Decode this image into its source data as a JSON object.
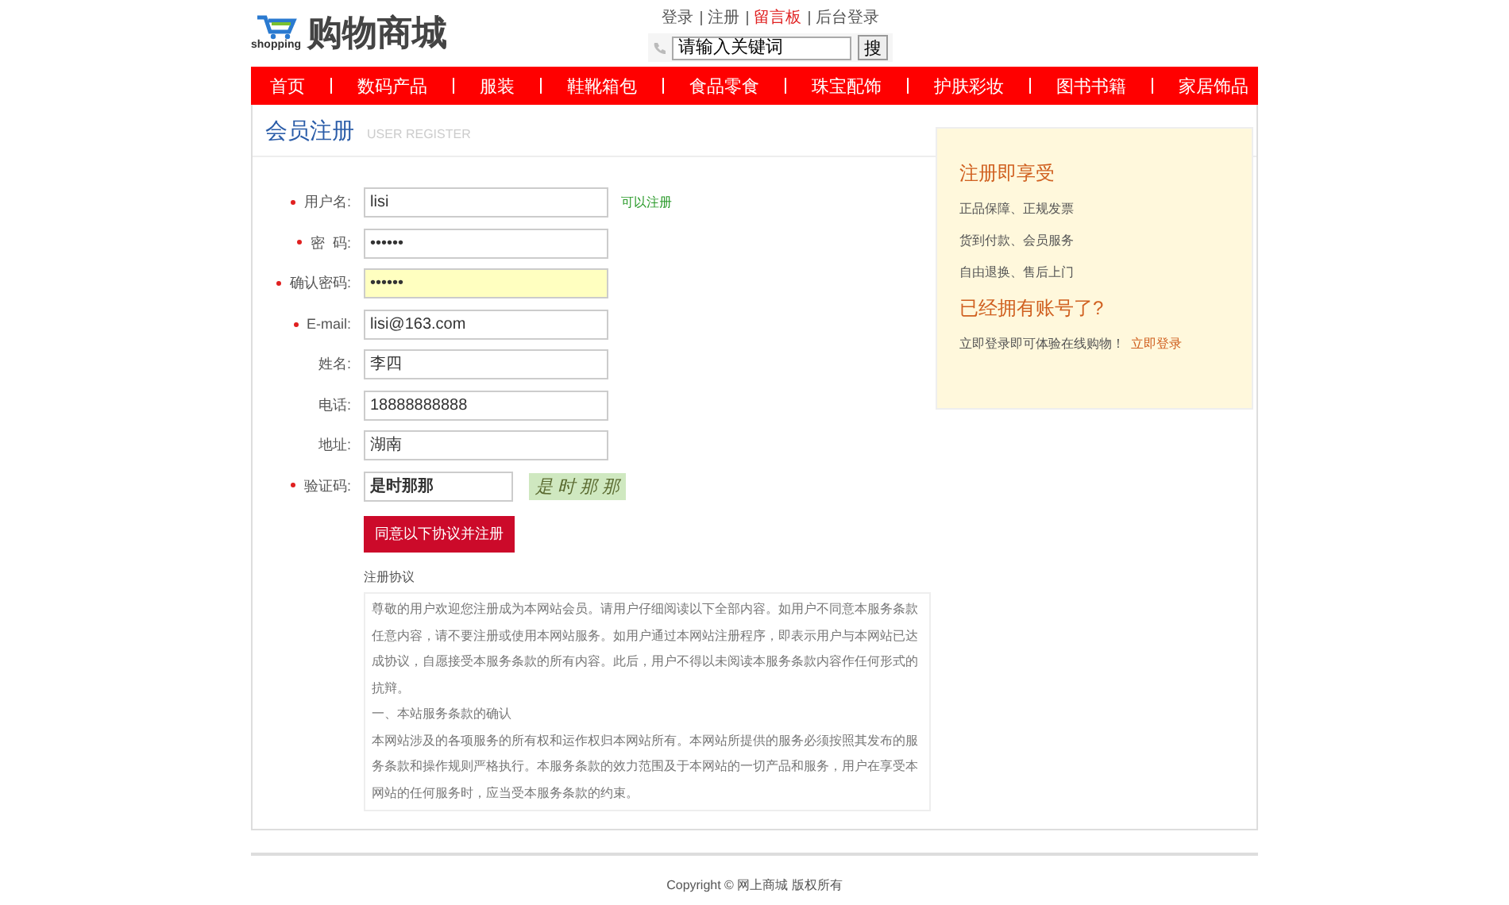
{
  "header": {
    "logo_caption": "shopping",
    "logo_title": "购物商城",
    "top_links": [
      {
        "label": "登录",
        "highlight": false
      },
      {
        "label": "注册",
        "highlight": false
      },
      {
        "label": "留言板",
        "highlight": true
      },
      {
        "label": "后台登录",
        "highlight": false
      }
    ],
    "search": {
      "value": "请输入关键词",
      "button": "搜"
    }
  },
  "nav": [
    "首页",
    "数码产品",
    "服装",
    "鞋靴箱包",
    "食品零食",
    "珠宝配饰",
    "护肤彩妆",
    "图书书籍",
    "家居饰品"
  ],
  "page_title": "会员注册",
  "page_subtitle": "USER REGISTER",
  "form": {
    "fields": [
      {
        "label": "用户名:",
        "required": true,
        "kind": "text",
        "value": "lisi",
        "highlight": false,
        "hint": "可以注册"
      },
      {
        "label": "密  码:",
        "required": true,
        "kind": "password",
        "value": "••••••",
        "highlight": false
      },
      {
        "label": "确认密码:",
        "required": true,
        "kind": "password",
        "value": "••••••",
        "highlight": true
      },
      {
        "label": "E-mail:",
        "required": true,
        "kind": "text",
        "value": "lisi@163.com",
        "highlight": false
      },
      {
        "label": "姓名:",
        "required": false,
        "kind": "text",
        "value": "李四",
        "highlight": false
      },
      {
        "label": "电话:",
        "required": false,
        "kind": "text",
        "value": "18888888888",
        "highlight": false
      },
      {
        "label": "地址:",
        "required": false,
        "kind": "text",
        "value": "湖南",
        "highlight": false
      },
      {
        "label": "验证码:",
        "required": true,
        "kind": "captcha",
        "value": "是时那那",
        "highlight": false
      }
    ],
    "captcha_image": "是 时 那 那",
    "submit": "同意以下协议并注册",
    "agreement_title": "注册协议",
    "agreement": [
      "尊敬的用户欢迎您注册成为本网站会员。请用户仔细阅读以下全部内容。如用户不同意本服务条款任意内容，请不要注册或使用本网站服务。如用户通过本网站注册程序，即表示用户与本网站已达成协议，自愿接受本服务条款的所有内容。此后，用户不得以未阅读本服务条款内容作任何形式的抗辩。",
      "一、本站服务条款的确认",
      "本网站涉及的各项服务的所有权和运作权归本网站所有。本网站所提供的服务必须按照其发布的服务条款和操作规则严格执行。本服务条款的效力范围及于本网站的一切产品和服务，用户在享受本网站的任何服务时，应当受本服务条款的约束。"
    ]
  },
  "side": {
    "title": "注册即享受",
    "items": [
      "正品保障、正规发票",
      "货到付款、会员服务",
      "自由退换、售后上门"
    ],
    "title2": "已经拥有账号了?",
    "note": "立即登录即可体验在线购物！",
    "link": "立即登录"
  },
  "footer": "Copyright © 网上商城 版权所有"
}
